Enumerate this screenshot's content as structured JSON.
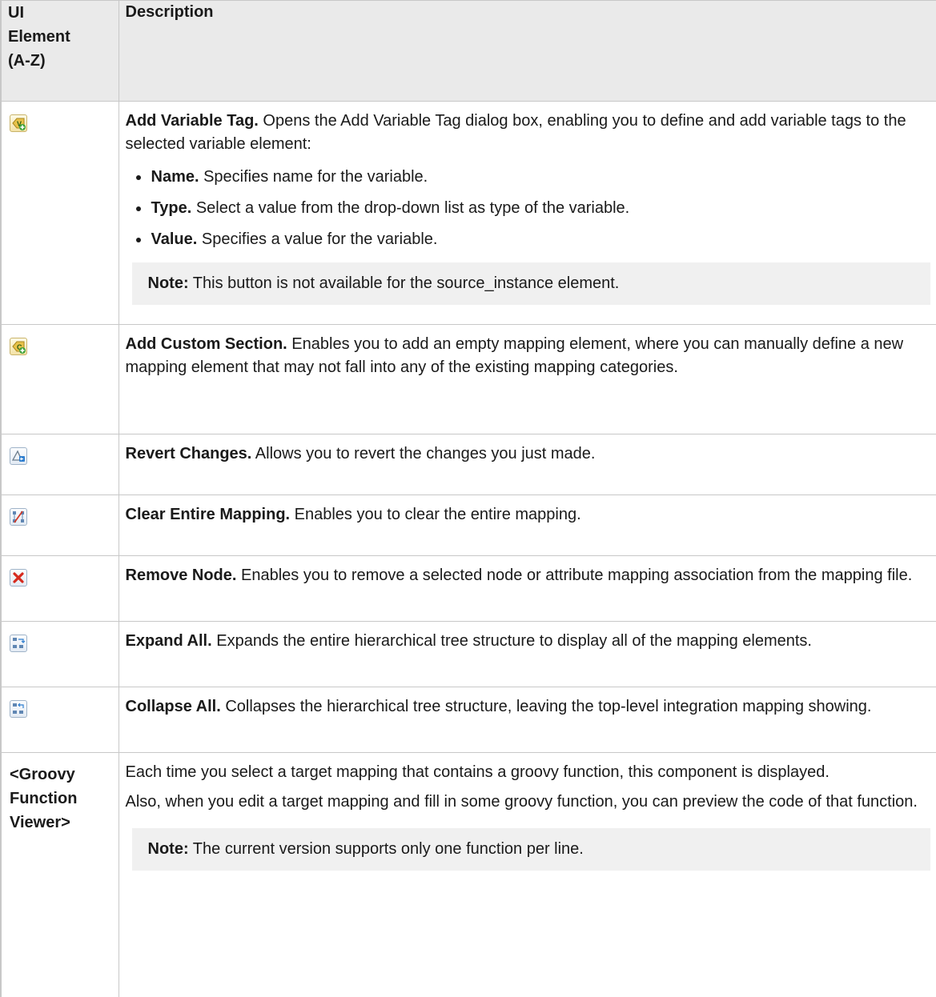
{
  "header": {
    "col1": [
      "UI",
      "Element",
      "(A-Z)"
    ],
    "col2": "Description"
  },
  "rows": [
    {
      "icon": "add-variable-tag-icon",
      "title": "Add Variable Tag.",
      "text": " Opens the Add Variable Tag dialog box, enabling you to define and add variable tags to the selected variable element:",
      "items": [
        {
          "title": "Name.",
          "text": " Specifies name for the variable."
        },
        {
          "title": "Type.",
          "text": " Select a value from the drop-down list as type of the variable."
        },
        {
          "title": "Value.",
          "text": " Specifies a value for the variable."
        }
      ],
      "note_label": "Note:",
      "note_text": " This button is not available for the source_instance element."
    },
    {
      "icon": "add-custom-section-icon",
      "title": "Add Custom Section.",
      "text": " Enables you to add an empty mapping element, where you can manually define a new mapping element that may not fall into any of the existing mapping categories."
    },
    {
      "icon": "revert-changes-icon",
      "title": "Revert Changes.",
      "text": " Allows you to revert the changes you just made."
    },
    {
      "icon": "clear-entire-mapping-icon",
      "title": "Clear Entire Mapping.",
      "text": " Enables you to clear the entire mapping."
    },
    {
      "icon": "remove-node-icon",
      "title": "Remove Node.",
      "text": " Enables you to remove a selected node or attribute mapping association from the mapping file."
    },
    {
      "icon": "expand-all-icon",
      "title": "Expand All.",
      "text": " Expands the entire hierarchical tree structure to display all of the mapping elements."
    },
    {
      "icon": "collapse-all-icon",
      "title": "Collapse All.",
      "text": " Collapses the hierarchical tree structure, leaving the top-level integration mapping showing."
    },
    {
      "label": [
        "<Groovy",
        "Function",
        "Viewer>"
      ],
      "para1": "Each time you select a target mapping that contains a groovy function, this component is displayed.",
      "para2": "Also, when you edit a target mapping and fill in some groovy function, you can preview the code of that function.",
      "note_label": "Note:",
      "note_text": " The current version supports only one function per line."
    }
  ],
  "colors": {
    "header_bg": "#eaeaea",
    "border": "#c8c8c8",
    "note_bg": "#f0f0f0"
  }
}
